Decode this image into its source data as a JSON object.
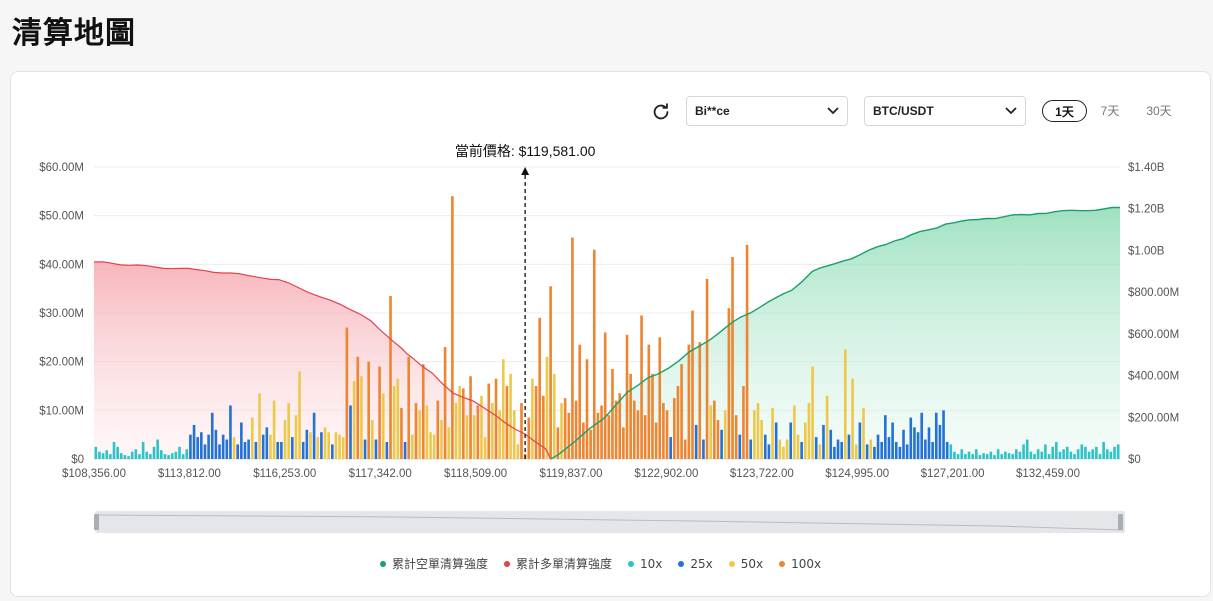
{
  "page": {
    "title": "清算地圖"
  },
  "controls": {
    "exchange": "Bi**ce",
    "pair": "BTC/USDT",
    "ranges": [
      {
        "label": "1天",
        "active": true
      },
      {
        "label": "7天",
        "active": false
      },
      {
        "label": "30天",
        "active": false
      }
    ]
  },
  "legend": [
    {
      "label": "累計空單清算強度",
      "color": "#1aa06d"
    },
    {
      "label": "累計多單清算強度",
      "color": "#e2424f"
    },
    {
      "label": "10x",
      "color": "#2ec3c8"
    },
    {
      "label": "25x",
      "color": "#2472d6"
    },
    {
      "label": "50x",
      "color": "#ecc94b"
    },
    {
      "label": "100x",
      "color": "#ee8532"
    }
  ],
  "chart_data": {
    "type": "bar",
    "current_price_label": "當前價格: $119,581.00",
    "x_tick_labels": [
      "$108,356.00",
      "$113,812.00",
      "$116,253.00",
      "$117,342.00",
      "$118,509.00",
      "$119,837.00",
      "$122,902.00",
      "$123,722.00",
      "$124,995.00",
      "$127,201.00",
      "$132,459.00"
    ],
    "y_left": {
      "ticks": [
        "$0",
        "$10.00M",
        "$20.00M",
        "$30.00M",
        "$40.00M",
        "$50.00M",
        "$60.00M"
      ],
      "range": [
        0,
        60
      ]
    },
    "y_right": {
      "ticks": [
        "$0",
        "$200.00M",
        "$400.00M",
        "$600.00M",
        "$800.00M",
        "$1.00B",
        "$1.20B",
        "$1.40B"
      ],
      "range": [
        0,
        1400
      ]
    },
    "grid": true,
    "leverage_colors": {
      "10x": "#2ec3c8",
      "25x": "#2472d6",
      "50x": "#ecc94b",
      "100x": "#ee8532"
    },
    "bars": [
      [
        "10x",
        2.5
      ],
      [
        "10x",
        1.5
      ],
      [
        "10x",
        1.2
      ],
      [
        "10x",
        1.8
      ],
      [
        "10x",
        1.0
      ],
      [
        "10x",
        3.5
      ],
      [
        "10x",
        2.5
      ],
      [
        "10x",
        1.2
      ],
      [
        "10x",
        0.8
      ],
      [
        "10x",
        0.6
      ],
      [
        "10x",
        1.5
      ],
      [
        "10x",
        2.0
      ],
      [
        "10x",
        1.0
      ],
      [
        "10x",
        3.5
      ],
      [
        "10x",
        1.5
      ],
      [
        "10x",
        1.0
      ],
      [
        "10x",
        2.5
      ],
      [
        "10x",
        4.0
      ],
      [
        "10x",
        1.8
      ],
      [
        "10x",
        1.0
      ],
      [
        "10x",
        0.8
      ],
      [
        "10x",
        1.2
      ],
      [
        "10x",
        1.5
      ],
      [
        "10x",
        2.5
      ],
      [
        "10x",
        1.0
      ],
      [
        "10x",
        2.0
      ],
      [
        "25x",
        5.0
      ],
      [
        "25x",
        7.0
      ],
      [
        "25x",
        4.5
      ],
      [
        "25x",
        5.5
      ],
      [
        "25x",
        3.0
      ],
      [
        "25x",
        5.0
      ],
      [
        "25x",
        9.5
      ],
      [
        "25x",
        6.0
      ],
      [
        "25x",
        3.0
      ],
      [
        "25x",
        5.0
      ],
      [
        "25x",
        4.0
      ],
      [
        "25x",
        11.0
      ],
      [
        "50x",
        4.5
      ],
      [
        "25x",
        3.0
      ],
      [
        "25x",
        7.5
      ],
      [
        "25x",
        3.5
      ],
      [
        "25x",
        4.0
      ],
      [
        "50x",
        8.5
      ],
      [
        "25x",
        3.5
      ],
      [
        "50x",
        13.5
      ],
      [
        "25x",
        5.0
      ],
      [
        "25x",
        6.5
      ],
      [
        "50x",
        5.0
      ],
      [
        "50x",
        12.0
      ],
      [
        "25x",
        3.5
      ],
      [
        "25x",
        3.5
      ],
      [
        "50x",
        8.0
      ],
      [
        "50x",
        11.5
      ],
      [
        "25x",
        4.5
      ],
      [
        "50x",
        9.0
      ],
      [
        "50x",
        18.0
      ],
      [
        "25x",
        3.5
      ],
      [
        "25x",
        6.0
      ],
      [
        "50x",
        5.5
      ],
      [
        "25x",
        9.5
      ],
      [
        "50x",
        4.5
      ],
      [
        "25x",
        5.5
      ],
      [
        "50x",
        6.5
      ],
      [
        "50x",
        5.5
      ],
      [
        "25x",
        3.0
      ],
      [
        "50x",
        5.5
      ],
      [
        "50x",
        5.0
      ],
      [
        "50x",
        4.5
      ],
      [
        "100x",
        27.0
      ],
      [
        "25x",
        11.0
      ],
      [
        "50x",
        16.0
      ],
      [
        "100x",
        21.0
      ],
      [
        "50x",
        17.0
      ],
      [
        "25x",
        4.0
      ],
      [
        "100x",
        20.0
      ],
      [
        "50x",
        8.0
      ],
      [
        "25x",
        4.0
      ],
      [
        "100x",
        19.0
      ],
      [
        "50x",
        13.5
      ],
      [
        "25x",
        3.5
      ],
      [
        "100x",
        33.5
      ],
      [
        "50x",
        15.0
      ],
      [
        "50x",
        16.5
      ],
      [
        "100x",
        10.5
      ],
      [
        "25x",
        3.5
      ],
      [
        "100x",
        21.0
      ],
      [
        "50x",
        5.0
      ],
      [
        "100x",
        11.5
      ],
      [
        "50x",
        10.0
      ],
      [
        "100x",
        19.5
      ],
      [
        "50x",
        11.0
      ],
      [
        "50x",
        5.5
      ],
      [
        "50x",
        5.0
      ],
      [
        "100x",
        12.0
      ],
      [
        "50x",
        8.0
      ],
      [
        "100x",
        23.0
      ],
      [
        "50x",
        6.5
      ],
      [
        "100x",
        54.0
      ],
      [
        "50x",
        11.5
      ],
      [
        "50x",
        15.0
      ],
      [
        "100x",
        14.5
      ],
      [
        "50x",
        9.0
      ],
      [
        "100x",
        17.0
      ],
      [
        "50x",
        9.0
      ],
      [
        "100x",
        11.0
      ],
      [
        "50x",
        13.0
      ],
      [
        "50x",
        4.5
      ],
      [
        "100x",
        15.5
      ],
      [
        "50x",
        11.5
      ],
      [
        "100x",
        16.5
      ],
      [
        "50x",
        10.0
      ],
      [
        "50x",
        20.5
      ],
      [
        "100x",
        15.0
      ],
      [
        "50x",
        17.5
      ],
      [
        "50x",
        10.0
      ],
      [
        "50x",
        3.0
      ],
      [
        "100x",
        11.5
      ],
      [
        "100x",
        1.0
      ],
      [
        "100x",
        8.5
      ],
      [
        "50x",
        16.5
      ],
      [
        "100x",
        15.0
      ],
      [
        "100x",
        29.0
      ],
      [
        "100x",
        13.0
      ],
      [
        "50x",
        21.0
      ],
      [
        "100x",
        35.5
      ],
      [
        "50x",
        17.5
      ],
      [
        "100x",
        6.5
      ],
      [
        "50x",
        11.5
      ],
      [
        "100x",
        12.5
      ],
      [
        "100x",
        9.5
      ],
      [
        "100x",
        45.5
      ],
      [
        "100x",
        12.0
      ],
      [
        "100x",
        23.5
      ],
      [
        "100x",
        7.5
      ],
      [
        "100x",
        20.5
      ],
      [
        "100x",
        6.0
      ],
      [
        "100x",
        43.0
      ],
      [
        "100x",
        9.5
      ],
      [
        "100x",
        11.0
      ],
      [
        "100x",
        26.0
      ],
      [
        "100x",
        9.0
      ],
      [
        "100x",
        18.5
      ],
      [
        "100x",
        12.0
      ],
      [
        "100x",
        13.5
      ],
      [
        "100x",
        6.5
      ],
      [
        "100x",
        25.5
      ],
      [
        "100x",
        17.5
      ],
      [
        "100x",
        12.0
      ],
      [
        "100x",
        10.0
      ],
      [
        "100x",
        29.5
      ],
      [
        "100x",
        9.0
      ],
      [
        "100x",
        23.5
      ],
      [
        "100x",
        17.5
      ],
      [
        "100x",
        7.5
      ],
      [
        "100x",
        25.0
      ],
      [
        "100x",
        11.5
      ],
      [
        "100x",
        10.0
      ],
      [
        "25x",
        4.5
      ],
      [
        "100x",
        12.5
      ],
      [
        "100x",
        15.0
      ],
      [
        "100x",
        19.5
      ],
      [
        "100x",
        4.0
      ],
      [
        "100x",
        23.5
      ],
      [
        "100x",
        30.5
      ],
      [
        "25x",
        7.0
      ],
      [
        "100x",
        24.0
      ],
      [
        "25x",
        4.0
      ],
      [
        "100x",
        37.0
      ],
      [
        "50x",
        11.0
      ],
      [
        "100x",
        12.0
      ],
      [
        "100x",
        8.0
      ],
      [
        "25x",
        6.0
      ],
      [
        "50x",
        10.0
      ],
      [
        "100x",
        31.0
      ],
      [
        "100x",
        41.5
      ],
      [
        "100x",
        9.0
      ],
      [
        "25x",
        5.0
      ],
      [
        "100x",
        15.0
      ],
      [
        "100x",
        44.0
      ],
      [
        "25x",
        4.0
      ],
      [
        "50x",
        10.0
      ],
      [
        "50x",
        11.5
      ],
      [
        "50x",
        8.0
      ],
      [
        "25x",
        5.0
      ],
      [
        "25x",
        3.0
      ],
      [
        "50x",
        10.5
      ],
      [
        "25x",
        7.5
      ],
      [
        "50x",
        4.0
      ],
      [
        "50x",
        2.5
      ],
      [
        "50x",
        4.0
      ],
      [
        "25x",
        7.5
      ],
      [
        "50x",
        11.0
      ],
      [
        "50x",
        5.0
      ],
      [
        "25x",
        3.5
      ],
      [
        "50x",
        7.5
      ],
      [
        "50x",
        11.5
      ],
      [
        "50x",
        19.0
      ],
      [
        "25x",
        4.5
      ],
      [
        "50x",
        3.0
      ],
      [
        "25x",
        7.0
      ],
      [
        "50x",
        13.0
      ],
      [
        "25x",
        6.0
      ],
      [
        "25x",
        2.5
      ],
      [
        "25x",
        4.0
      ],
      [
        "25x",
        3.5
      ],
      [
        "50x",
        22.5
      ],
      [
        "25x",
        5.0
      ],
      [
        "50x",
        16.5
      ],
      [
        "50x",
        3.0
      ],
      [
        "25x",
        7.5
      ],
      [
        "50x",
        10.5
      ],
      [
        "25x",
        3.0
      ],
      [
        "50x",
        4.0
      ],
      [
        "25x",
        2.5
      ],
      [
        "25x",
        5.0
      ],
      [
        "25x",
        3.5
      ],
      [
        "25x",
        9.0
      ],
      [
        "25x",
        4.5
      ],
      [
        "25x",
        7.5
      ],
      [
        "25x",
        3.5
      ],
      [
        "25x",
        2.5
      ],
      [
        "25x",
        6.0
      ],
      [
        "25x",
        3.0
      ],
      [
        "25x",
        8.5
      ],
      [
        "25x",
        6.5
      ],
      [
        "25x",
        5.5
      ],
      [
        "25x",
        9.5
      ],
      [
        "25x",
        4.0
      ],
      [
        "25x",
        6.5
      ],
      [
        "25x",
        3.5
      ],
      [
        "25x",
        9.5
      ],
      [
        "25x",
        7.0
      ],
      [
        "25x",
        10.0
      ],
      [
        "25x",
        3.5
      ],
      [
        "10x",
        3.0
      ],
      [
        "10x",
        1.5
      ],
      [
        "10x",
        1.0
      ],
      [
        "10x",
        2.0
      ],
      [
        "10x",
        1.0
      ],
      [
        "10x",
        1.5
      ],
      [
        "10x",
        1.0
      ],
      [
        "10x",
        2.0
      ],
      [
        "10x",
        0.8
      ],
      [
        "10x",
        1.2
      ],
      [
        "10x",
        1.0
      ],
      [
        "10x",
        1.5
      ],
      [
        "10x",
        0.8
      ],
      [
        "10x",
        2.0
      ],
      [
        "10x",
        1.0
      ],
      [
        "10x",
        1.5
      ],
      [
        "10x",
        1.2
      ],
      [
        "10x",
        1.0
      ],
      [
        "10x",
        2.0
      ],
      [
        "10x",
        1.5
      ],
      [
        "10x",
        3.0
      ],
      [
        "10x",
        4.0
      ],
      [
        "10x",
        1.5
      ],
      [
        "10x",
        1.0
      ],
      [
        "10x",
        2.0
      ],
      [
        "10x",
        1.5
      ],
      [
        "10x",
        3.0
      ],
      [
        "10x",
        1.0
      ],
      [
        "10x",
        2.5
      ],
      [
        "10x",
        3.5
      ],
      [
        "10x",
        1.5
      ],
      [
        "10x",
        2.0
      ],
      [
        "10x",
        2.5
      ],
      [
        "10x",
        1.5
      ],
      [
        "10x",
        1.0
      ],
      [
        "10x",
        2.0
      ],
      [
        "10x",
        3.0
      ],
      [
        "10x",
        2.5
      ],
      [
        "10x",
        1.5
      ],
      [
        "10x",
        2.0
      ],
      [
        "10x",
        2.5
      ],
      [
        "10x",
        1.0
      ],
      [
        "10x",
        3.5
      ],
      [
        "10x",
        2.0
      ],
      [
        "10x",
        1.5
      ],
      [
        "10x",
        2.5
      ],
      [
        "10x",
        3.0
      ]
    ],
    "current_price_bar_index": 118,
    "long_cumulative": [
      [
        0,
        945
      ],
      [
        0.06,
        920
      ],
      [
        0.1,
        908
      ],
      [
        0.15,
        880
      ],
      [
        0.18,
        860
      ],
      [
        0.2,
        820
      ],
      [
        0.23,
        762
      ],
      [
        0.25,
        716
      ],
      [
        0.27,
        662
      ],
      [
        0.3,
        530
      ],
      [
        0.31,
        486
      ],
      [
        0.33,
        410
      ],
      [
        0.35,
        316
      ],
      [
        0.37,
        277
      ],
      [
        0.4,
        176
      ],
      [
        0.42,
        120
      ],
      [
        0.44,
        50
      ],
      [
        0.445,
        0
      ]
    ],
    "short_cumulative": [
      [
        0.445,
        0
      ],
      [
        0.46,
        50
      ],
      [
        0.49,
        170
      ],
      [
        0.5,
        210
      ],
      [
        0.52,
        321
      ],
      [
        0.54,
        390
      ],
      [
        0.56,
        436
      ],
      [
        0.58,
        513
      ],
      [
        0.6,
        570
      ],
      [
        0.63,
        680
      ],
      [
        0.65,
        730
      ],
      [
        0.68,
        809
      ],
      [
        0.7,
        899
      ],
      [
        0.73,
        949
      ],
      [
        0.78,
        1045
      ],
      [
        0.83,
        1126
      ],
      [
        0.87,
        1153
      ],
      [
        0.92,
        1177
      ],
      [
        1,
        1206
      ]
    ]
  }
}
